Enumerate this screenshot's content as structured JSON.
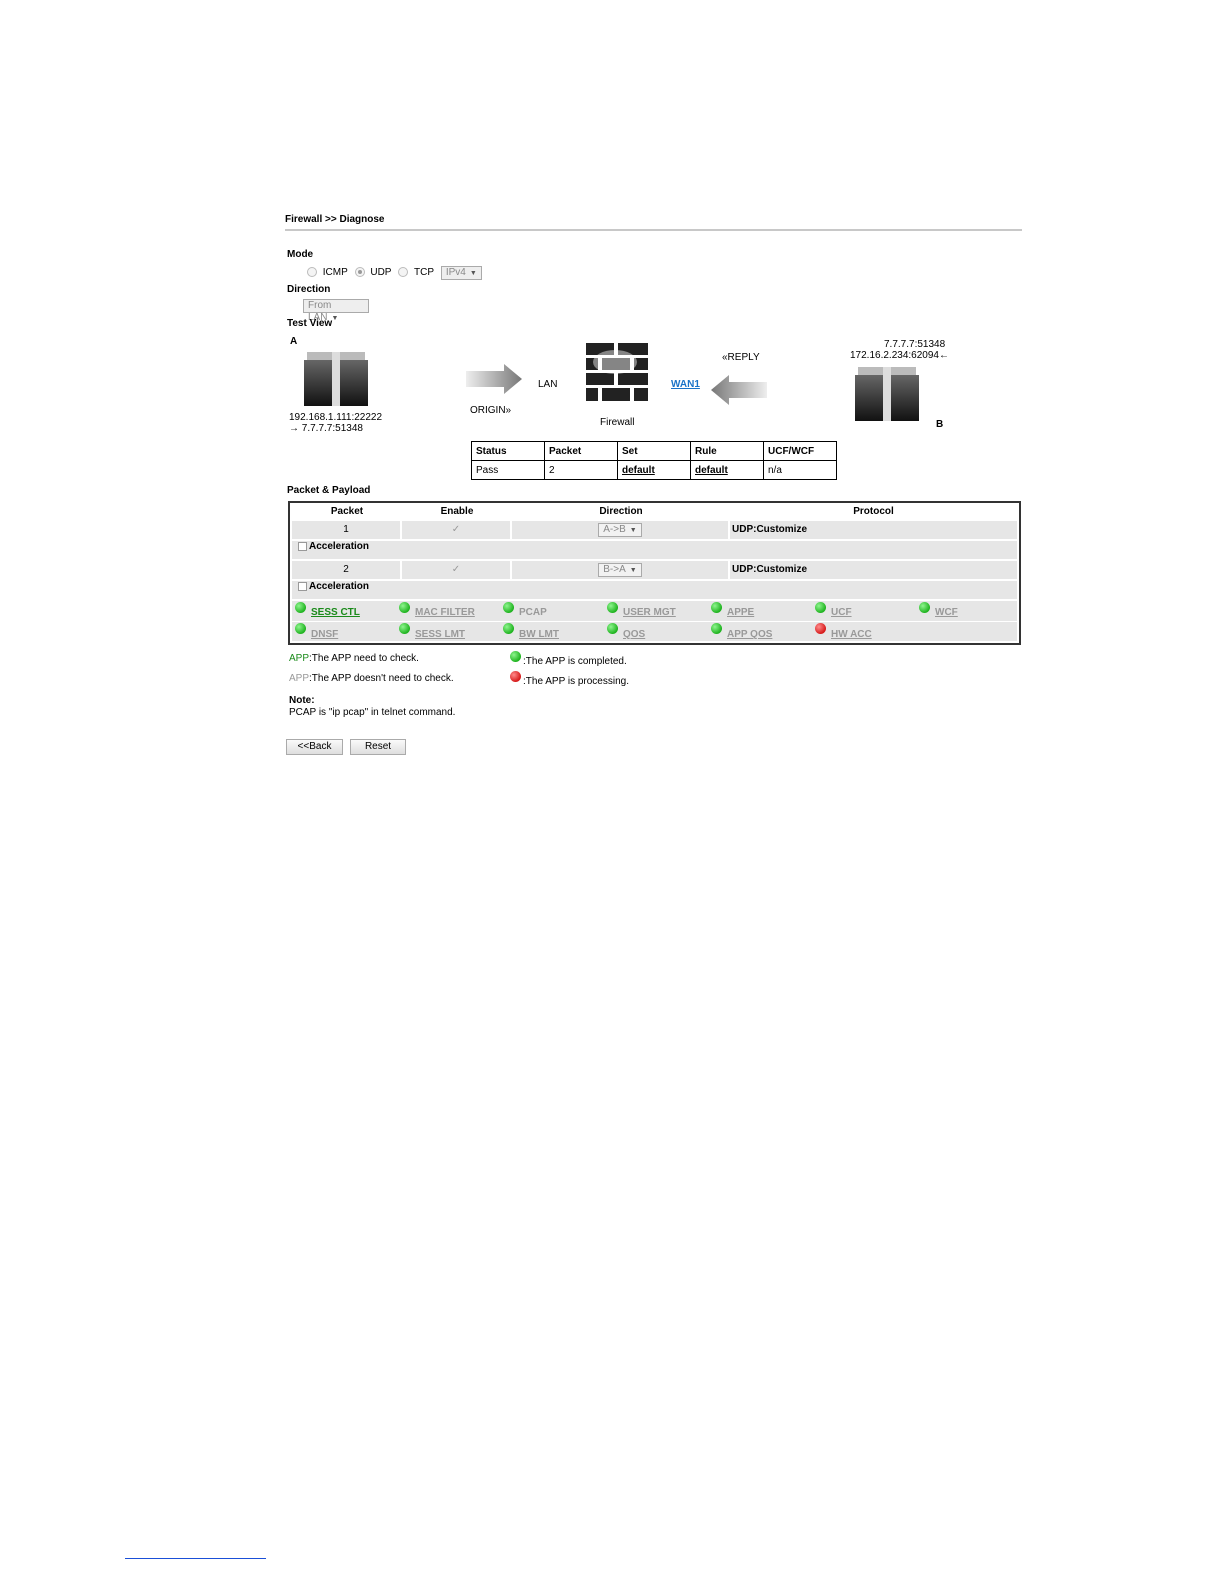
{
  "breadcrumb": "Firewall >> Diagnose",
  "mode": {
    "label": "Mode",
    "options": [
      "ICMP",
      "UDP",
      "TCP"
    ],
    "selected": "UDP",
    "ip_version": "IPv4"
  },
  "direction": {
    "label": "Direction",
    "value": "From LAN"
  },
  "test_view": {
    "label": "Test View",
    "host_a": {
      "label": "A",
      "addr1": "192.168.1.111:22222",
      "addr2": "→ 7.7.7.7:51348"
    },
    "host_b": {
      "label": "B",
      "addr1": "7.7.7.7:51348",
      "addr2": "172.16.2.234:62094←"
    },
    "lan": "LAN",
    "origin": "ORIGIN»",
    "firewall": "Firewall",
    "wan": "WAN1",
    "reply": "«REPLY"
  },
  "status_table": {
    "headers": [
      "Status",
      "Packet",
      "Set",
      "Rule",
      "UCF/WCF"
    ],
    "row": [
      "Pass",
      "2",
      "default",
      "default",
      "n/a"
    ]
  },
  "packet_payload": {
    "label": "Packet & Payload",
    "headers": [
      "Packet",
      "Enable",
      "Direction",
      "Protocol"
    ],
    "rows": [
      {
        "packet": "1",
        "enable": "✓",
        "direction": "A->B",
        "protocol": "UDP:Customize"
      },
      {
        "packet": "2",
        "enable": "✓",
        "direction": "B->A",
        "protocol": "UDP:Customize"
      }
    ],
    "acceleration": "Acceleration",
    "apps_row1": [
      "SESS CTL",
      "MAC FILTER",
      "PCAP",
      "USER MGT",
      "APPE",
      "UCF",
      "WCF"
    ],
    "apps_row2": [
      "DNSF",
      "SESS LMT",
      "BW LMT",
      "QOS",
      "APP QOS",
      "HW ACC"
    ],
    "app_colors": {
      "done": "#1fb31f",
      "processing": "#d61a1a"
    }
  },
  "legend": {
    "app_prefix": "APP",
    "need_check": ":The APP need to check.",
    "no_check": ":The APP doesn't need to check.",
    "completed": ":The APP is completed.",
    "processing": ":The APP is processing."
  },
  "note": {
    "title": "Note:",
    "text": "PCAP is \"ip pcap\" in telnet command."
  },
  "buttons": {
    "back": "<<Back",
    "reset": "Reset"
  }
}
